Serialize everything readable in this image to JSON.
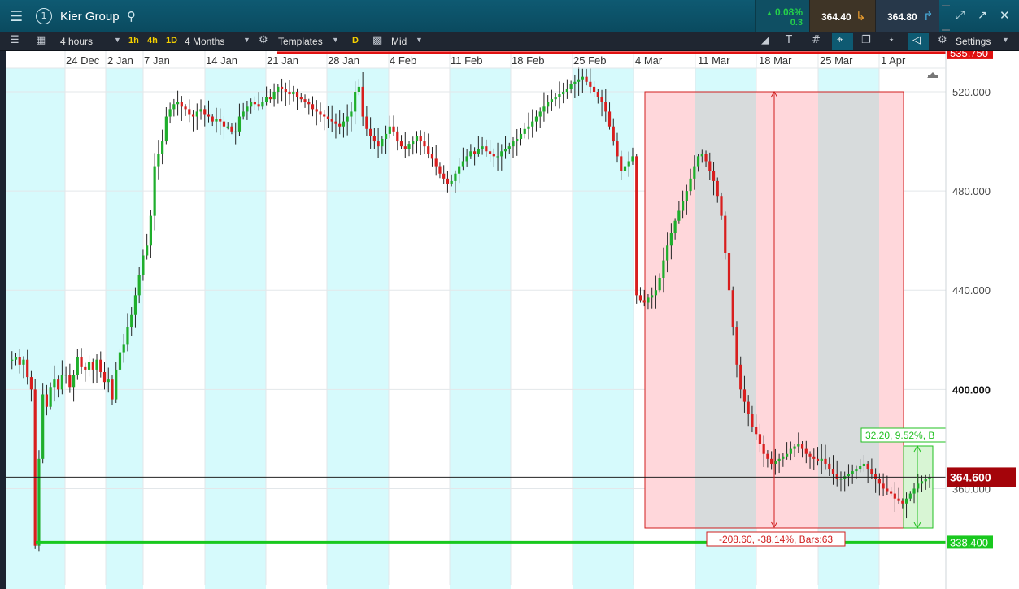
{
  "header": {
    "instrument": "Kier Group",
    "change_pct": "0.08%",
    "change_abs": "0.3",
    "sell_price": "364.40",
    "buy_price": "364.80",
    "menu_icon": "hamburger-icon",
    "info_icon": "info-circle-icon",
    "search_icon": "search-icon"
  },
  "toolbar": {
    "interval": "4 hours",
    "quick": [
      "1h",
      "4h",
      "1D"
    ],
    "range": "4 Months",
    "templates": "Templates",
    "d_label": "D",
    "price_type": "Mid",
    "settings": "Settings"
  },
  "chart_data": {
    "type": "candlestick",
    "x_ticks": [
      "24 Dec",
      "2 Jan",
      "7 Jan",
      "14 Jan",
      "21 Jan",
      "28 Jan",
      "4 Feb",
      "11 Feb",
      "18 Feb",
      "25 Feb",
      "4 Mar",
      "11 Mar",
      "18 Mar",
      "25 Mar",
      "1 Apr"
    ],
    "y_ticks": [
      "360.000",
      "400.000",
      "440.000",
      "480.000",
      "520.000"
    ],
    "ylim": [
      330,
      545
    ],
    "current_price_label": "364.600",
    "resistance_label": "535.750",
    "support_label": "338.400",
    "resistance_value": 535.75,
    "support_value": 338.4,
    "current_value": 364.6,
    "measure_big_label": "-208.60, -38.14%, Bars:63",
    "measure_small_label": "32.20, 9.52%, B",
    "colors": {
      "up": "#1fae2c",
      "down": "#d81e1e",
      "resistance": "#e01010",
      "support": "#18c81e"
    },
    "path_points": [
      412,
      412,
      413,
      410,
      412,
      405,
      400,
      337,
      372,
      398,
      393,
      401,
      404,
      400,
      406,
      406,
      401,
      406,
      413,
      409,
      408,
      411,
      408,
      412,
      407,
      403,
      404,
      396,
      408,
      415,
      418,
      425,
      430,
      438,
      446,
      454,
      458,
      470,
      490,
      495,
      500,
      510,
      513,
      515,
      516,
      514,
      513,
      511,
      510,
      512,
      513,
      511,
      510,
      508,
      509,
      508,
      506,
      506,
      504,
      504,
      510,
      512,
      514,
      516,
      515,
      514,
      516,
      518,
      517,
      520,
      522,
      521,
      520,
      519,
      520,
      518,
      517,
      516,
      515,
      513,
      512,
      511,
      510,
      509,
      508,
      507,
      506,
      508,
      510,
      512,
      520,
      522,
      510,
      505,
      502,
      500,
      498,
      501,
      503,
      506,
      504,
      500,
      498,
      497,
      499,
      500,
      502,
      500,
      498,
      495,
      493,
      490,
      487,
      485,
      483,
      484,
      487,
      490,
      492,
      494,
      496,
      495,
      497,
      498,
      496,
      495,
      494,
      494,
      496,
      497,
      498,
      500,
      501,
      503,
      505,
      506,
      508,
      510,
      512,
      514,
      516,
      517,
      518,
      519,
      520,
      521,
      523,
      524,
      525,
      526,
      524,
      522,
      520,
      518,
      516,
      512,
      506,
      500,
      494,
      488,
      490,
      492,
      494,
      438,
      436,
      435,
      437,
      438,
      440,
      445,
      452,
      458,
      463,
      468,
      472,
      476,
      480,
      485,
      490,
      494,
      495,
      492,
      488,
      484,
      478,
      470,
      455,
      440,
      425,
      410,
      400,
      395,
      390,
      385,
      382,
      378,
      374,
      372,
      370,
      371,
      372,
      373,
      374,
      376,
      377,
      378,
      376,
      374,
      373,
      372,
      371,
      372,
      370,
      368,
      366,
      364,
      364,
      365,
      366,
      367,
      368,
      369,
      370,
      368,
      366,
      364,
      362,
      360,
      359,
      358,
      356,
      355,
      354,
      356,
      358,
      360,
      362,
      363,
      364,
      364.6
    ]
  }
}
